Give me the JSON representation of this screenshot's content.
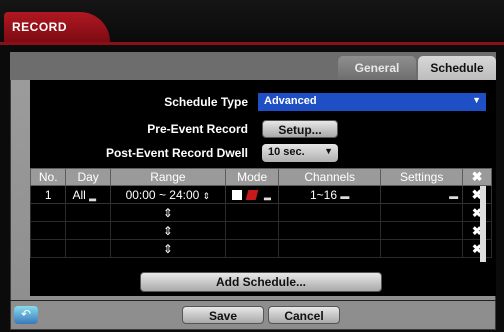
{
  "title": "RECORD",
  "tabs": [
    {
      "label": "General",
      "active": false
    },
    {
      "label": "Schedule",
      "active": true
    }
  ],
  "form": {
    "schedule_type_label": "Schedule Type",
    "schedule_type_value": "Advanced",
    "pre_event_label": "Pre-Event Record",
    "pre_event_button": "Setup...",
    "post_event_label": "Post-Event Record Dwell",
    "post_event_value": "10 sec."
  },
  "table": {
    "headers": [
      "No.",
      "Day",
      "Range",
      "Mode",
      "Channels",
      "Settings"
    ],
    "rows": [
      {
        "no": "1",
        "day": "All",
        "range": "00:00 ~ 24:00",
        "channels": "1~16"
      }
    ]
  },
  "buttons": {
    "add_schedule": "Add Schedule...",
    "save": "Save",
    "cancel": "Cancel"
  },
  "colors": {
    "accent_red": "#b01822",
    "selection_blue": "#1f4fc4"
  }
}
